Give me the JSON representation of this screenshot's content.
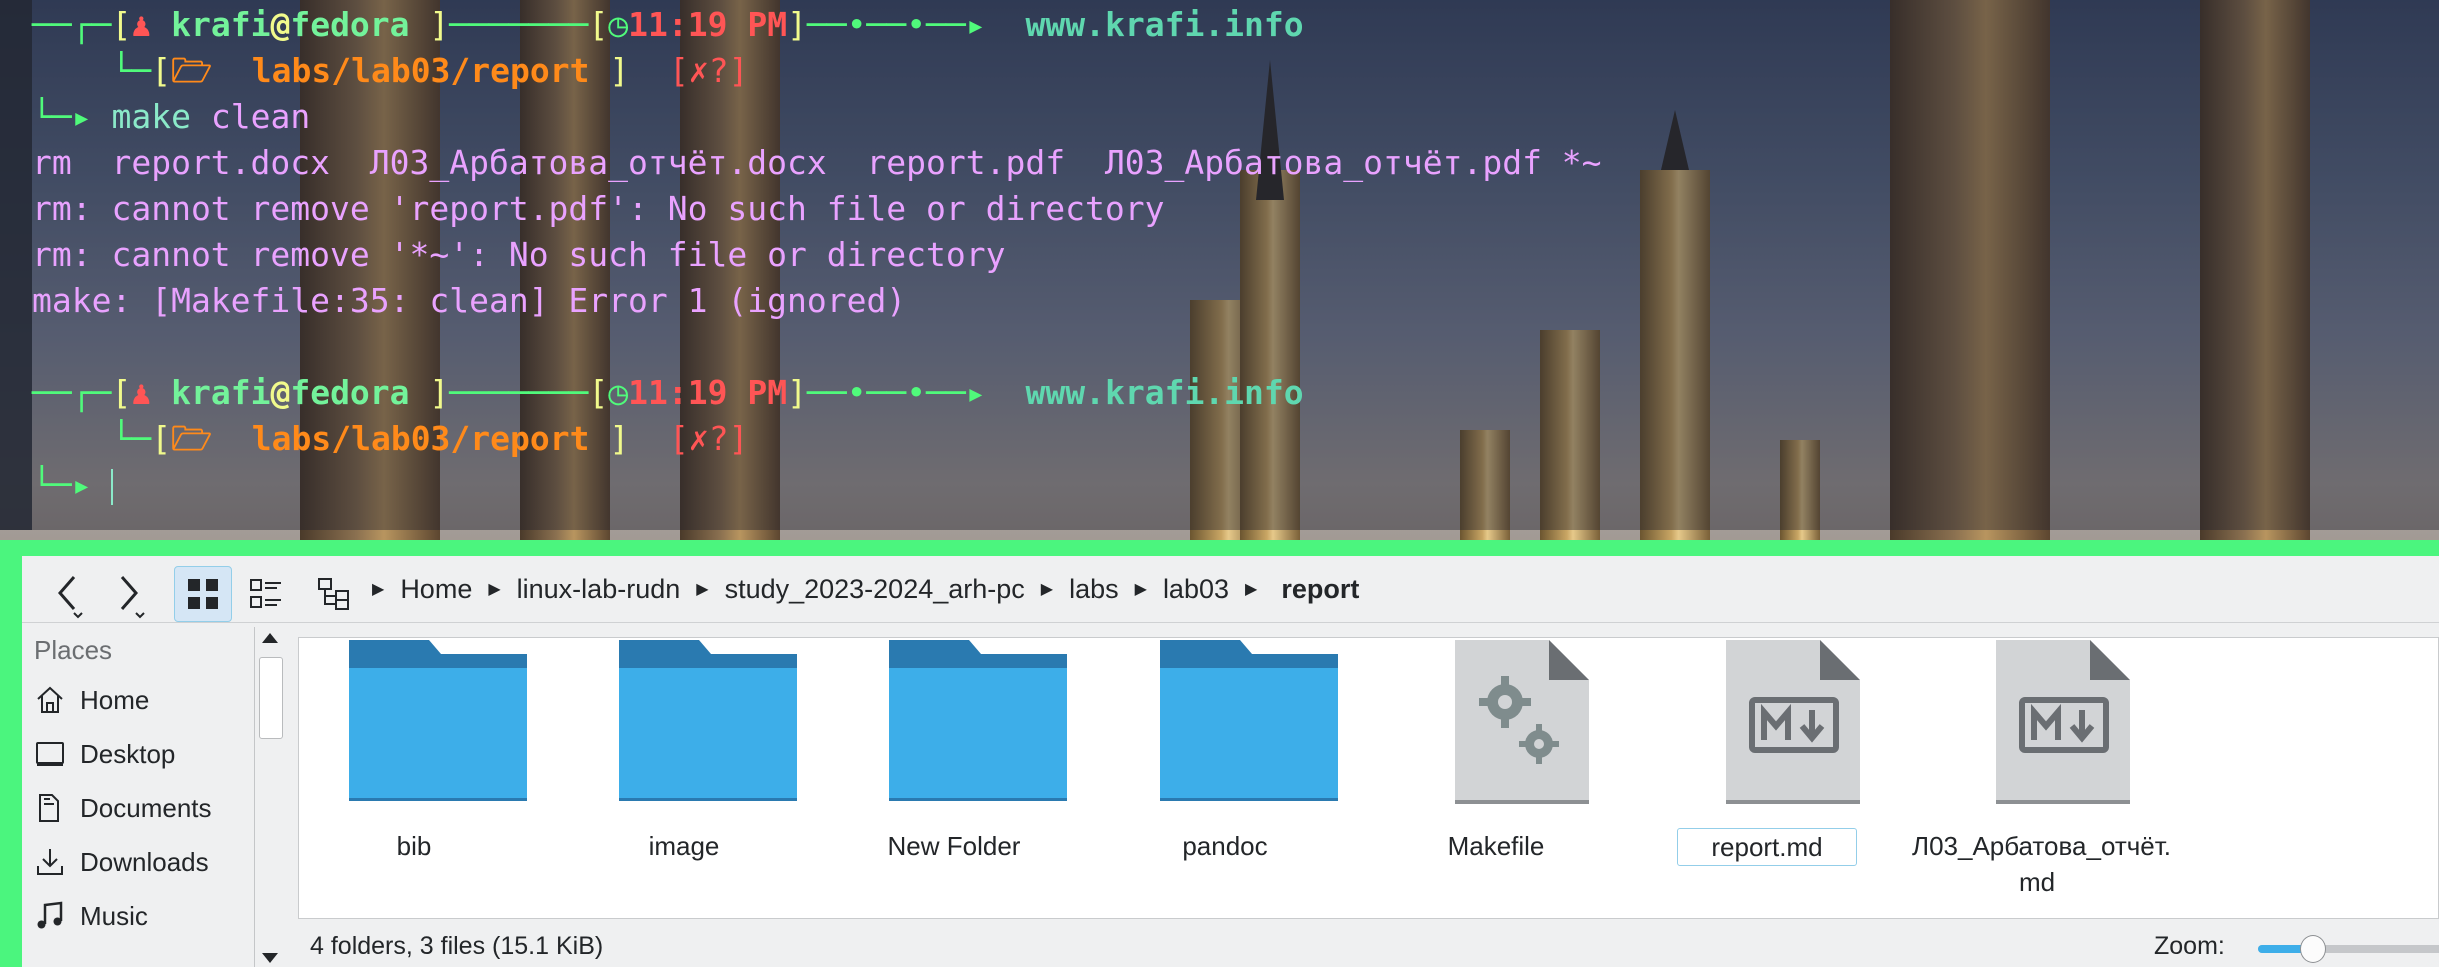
{
  "terminal": {
    "prompt1": {
      "user": "krafi",
      "at": "@",
      "host": "fedora",
      "time": "11:19 PM",
      "site": "www.krafi.info",
      "path": "labs/lab03/report",
      "status": "[✗?]",
      "command_keyword": "make",
      "command_arg": "clean"
    },
    "output": [
      "rm  report.docx  Л03_Арбатова_отчёт.docx  report.pdf  Л03_Арбатова_отчёт.pdf *~",
      "rm: cannot remove 'report.pdf': No such file or directory",
      "rm: cannot remove '*~': No such file or directory",
      "make: [Makefile:35: clean] Error 1 (ignored)"
    ],
    "prompt2": {
      "user": "krafi",
      "at": "@",
      "host": "fedora",
      "time": "11:19 PM",
      "site": "www.krafi.info",
      "path": "labs/lab03/report",
      "status": "[✗?]"
    }
  },
  "file_manager": {
    "toolbar": {
      "back_icon": "chevron-left-icon",
      "forward_icon": "chevron-right-icon",
      "view_modes": [
        "icons-view",
        "details-view",
        "tree-view"
      ]
    },
    "breadcrumb": [
      "Home",
      "linux-lab-rudn",
      "study_2023-2024_arh-pc",
      "labs",
      "lab03"
    ],
    "breadcrumb_current": "report",
    "sidebar": {
      "title": "Places",
      "items": [
        {
          "label": "Home",
          "icon": "home-icon"
        },
        {
          "label": "Desktop",
          "icon": "desktop-icon"
        },
        {
          "label": "Documents",
          "icon": "documents-icon"
        },
        {
          "label": "Downloads",
          "icon": "downloads-icon"
        },
        {
          "label": "Music",
          "icon": "music-icon"
        }
      ]
    },
    "items": [
      {
        "name": "bib",
        "type": "folder"
      },
      {
        "name": "image",
        "type": "folder"
      },
      {
        "name": "New Folder",
        "type": "folder"
      },
      {
        "name": "pandoc",
        "type": "folder"
      },
      {
        "name": "Makefile",
        "type": "makefile"
      },
      {
        "name": "report.md",
        "type": "markdown",
        "selected": true
      },
      {
        "name": "Л03_Арбатова_отчёт.\nmd",
        "type": "markdown"
      }
    ],
    "status": {
      "summary": "4 folders, 3 files (15.1 KiB)",
      "zoom_label": "Zoom:",
      "zoom_level": 0.27
    },
    "colors": {
      "folder": "#3daee9",
      "folder_tab": "#2a7ab0",
      "window_border": "#4bf57e",
      "selection": "#93cee9"
    }
  }
}
